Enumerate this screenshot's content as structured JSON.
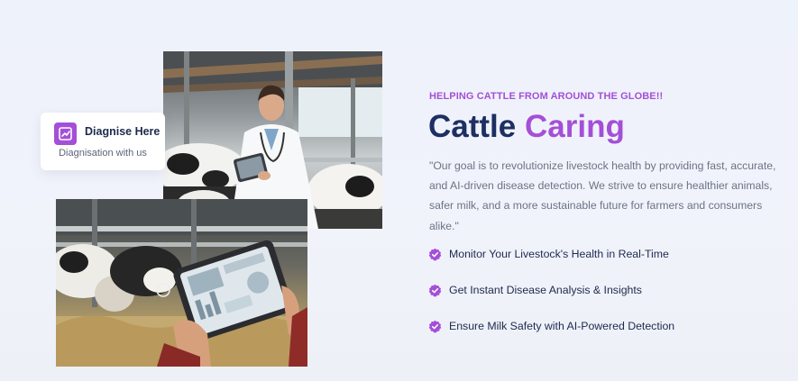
{
  "diagnose_card": {
    "title": "Diagnise Here",
    "subtitle": "Diagnisation with us",
    "icon": "chart-edit-icon"
  },
  "hero": {
    "eyebrow": "HELPING CATTLE FROM AROUND THE GLOBE!!",
    "title_part1": "Cattle",
    "title_part2": "Caring",
    "description": "\"Our goal is to revolutionize livestock health by providing fast, accurate, and AI-driven disease detection. We strive to ensure healthier animals, safer milk, and a more sustainable future for farmers and consumers alike.\""
  },
  "features": [
    {
      "label": "Monitor Your Livestock's Health in Real-Time",
      "icon": "verified-badge-icon"
    },
    {
      "label": "Get Instant Disease Analysis & Insights",
      "icon": "verified-badge-icon"
    },
    {
      "label": "Ensure Milk Safety with AI-Powered Detection",
      "icon": "verified-badge-icon"
    }
  ],
  "images": {
    "top": "vet-with-tablet-in-cattle-barn",
    "bottom": "hands-holding-tablet-over-cow-feed"
  },
  "colors": {
    "accent": "#a44fd8",
    "navy": "#1d2f63",
    "text_muted": "#6b7385",
    "background": "#eef2fb"
  }
}
